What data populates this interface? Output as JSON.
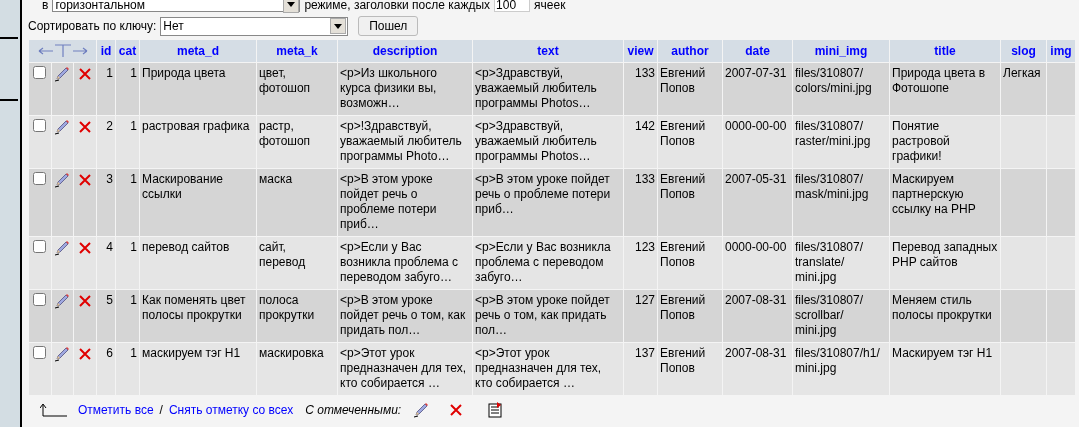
{
  "display": {
    "mode_prefix": "в",
    "mode_value": "горизонтальном",
    "mode_suffix": "режиме, заголовки после каждых",
    "repeat_value": "100",
    "repeat_suffix": "ячеек"
  },
  "sort": {
    "label": "Сортировать по ключу:",
    "value": "Нет",
    "button": "Пошел"
  },
  "table": {
    "columns": [
      "id",
      "cat",
      "meta_d",
      "meta_k",
      "description",
      "text",
      "view",
      "author",
      "date",
      "mini_img",
      "title",
      "slog",
      "img"
    ],
    "rows": [
      {
        "checked": false,
        "cells": [
          "1",
          "1",
          "Природа цвета",
          "цвет, фотошоп",
          "<p>Из школьного курса физики вы, возможн…",
          "<p>Здравствуй, уважаемый любитель программы Photos…",
          "133",
          "Евгений Попов",
          "2007-07-31",
          "files/310807/ colors/mini.jpg",
          "Природа цвета в Фотошопе",
          "Легкая"
        ]
      },
      {
        "checked": false,
        "cells": [
          "2",
          "1",
          "растровая графика",
          "растр, фотошоп",
          "<p>!Здравствуй, уважаемый любитель программы Photo…",
          "<p>Здравствуй, уважаемый любитель программы Photos…",
          "142",
          "Евгений Попов",
          "0000-00-00",
          "files/310807/ raster/mini.jpg",
          "Понятие растровой графики!"
        ]
      },
      {
        "checked": false,
        "cells": [
          "3",
          "1",
          "Маскирование ссылки",
          "маска",
          "<p>В этом уроке пойдет речь о проблеме потери приб…",
          "<p>В этом уроке пойдет речь о проблеме потери приб…",
          "133",
          "Евгений Попов",
          "2007-05-31",
          "files/310807/ mask/mini.jpg",
          "Маскируем партнерскую ссылку на PHP"
        ]
      },
      {
        "checked": false,
        "cells": [
          "4",
          "1",
          "перевод сайтов",
          "сайт, перевод",
          "<p>Если у Вас возникла проблема с переводом забуго…",
          "<p>Если у Вас возникла проблема с переводом забуго…",
          "123",
          "Евгений Попов",
          "0000-00-00",
          "files/310807/ translate/ mini.jpg",
          "Перевод западных PHP сайтов"
        ]
      },
      {
        "checked": false,
        "cells": [
          "5",
          "1",
          "Как поменять цвет полосы прокрутки",
          "полоса прокрутки",
          "<p>В этом уроке пойдет речь о том, как придать пол…",
          "<p>В этом уроке пойдет речь о том, как придать пол…",
          "127",
          "Евгений Попов",
          "2007-08-31",
          "files/310807/ scrollbar/ mini.jpg",
          "Меняем стиль полосы прокрутки"
        ]
      },
      {
        "checked": false,
        "cells": [
          "6",
          "1",
          "маскируем тэг H1",
          "маскировка",
          "<p>Этот урок предназначен для тех, кто собирается …",
          "<p>Этот урок предназначен для тех, кто собирается …",
          "137",
          "Евгений Попов",
          "2007-08-31",
          "files/310807/h1/ mini.jpg",
          "Маскируем тэг H1"
        ]
      }
    ]
  },
  "footer": {
    "check_all": "Отметить все",
    "separator": "/",
    "uncheck_all": "Снять отметку со всех",
    "with_selected": "С отмеченными:"
  }
}
